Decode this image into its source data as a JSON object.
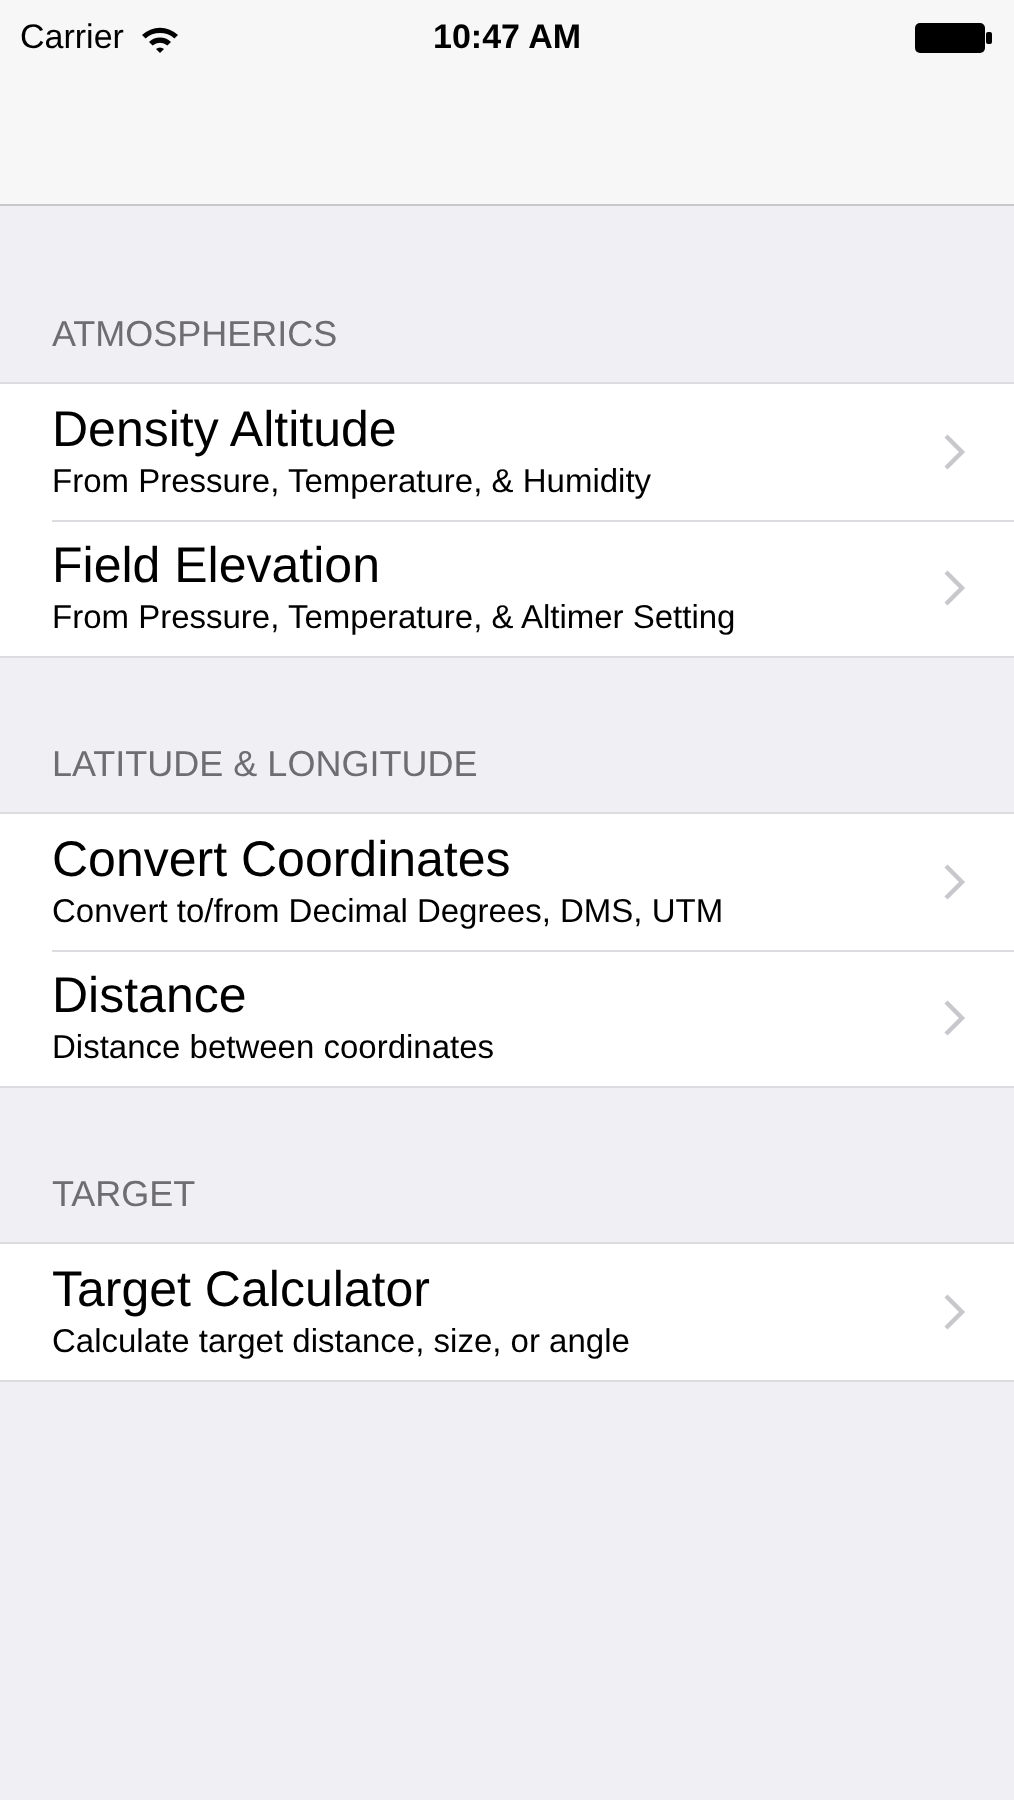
{
  "status_bar": {
    "carrier": "Carrier",
    "time": "10:47 AM"
  },
  "sections": [
    {
      "header": "ATMOSPHERICS",
      "rows": [
        {
          "title": "Density Altitude",
          "subtitle": "From Pressure, Temperature, & Humidity"
        },
        {
          "title": "Field Elevation",
          "subtitle": "From Pressure, Temperature, & Altimer Setting"
        }
      ]
    },
    {
      "header": "LATITUDE & LONGITUDE",
      "rows": [
        {
          "title": "Convert Coordinates",
          "subtitle": "Convert to/from Decimal Degrees, DMS, UTM"
        },
        {
          "title": "Distance",
          "subtitle": "Distance between coordinates"
        }
      ]
    },
    {
      "header": "TARGET",
      "rows": [
        {
          "title": "Target Calculator",
          "subtitle": "Calculate target distance, size, or angle"
        }
      ]
    }
  ]
}
